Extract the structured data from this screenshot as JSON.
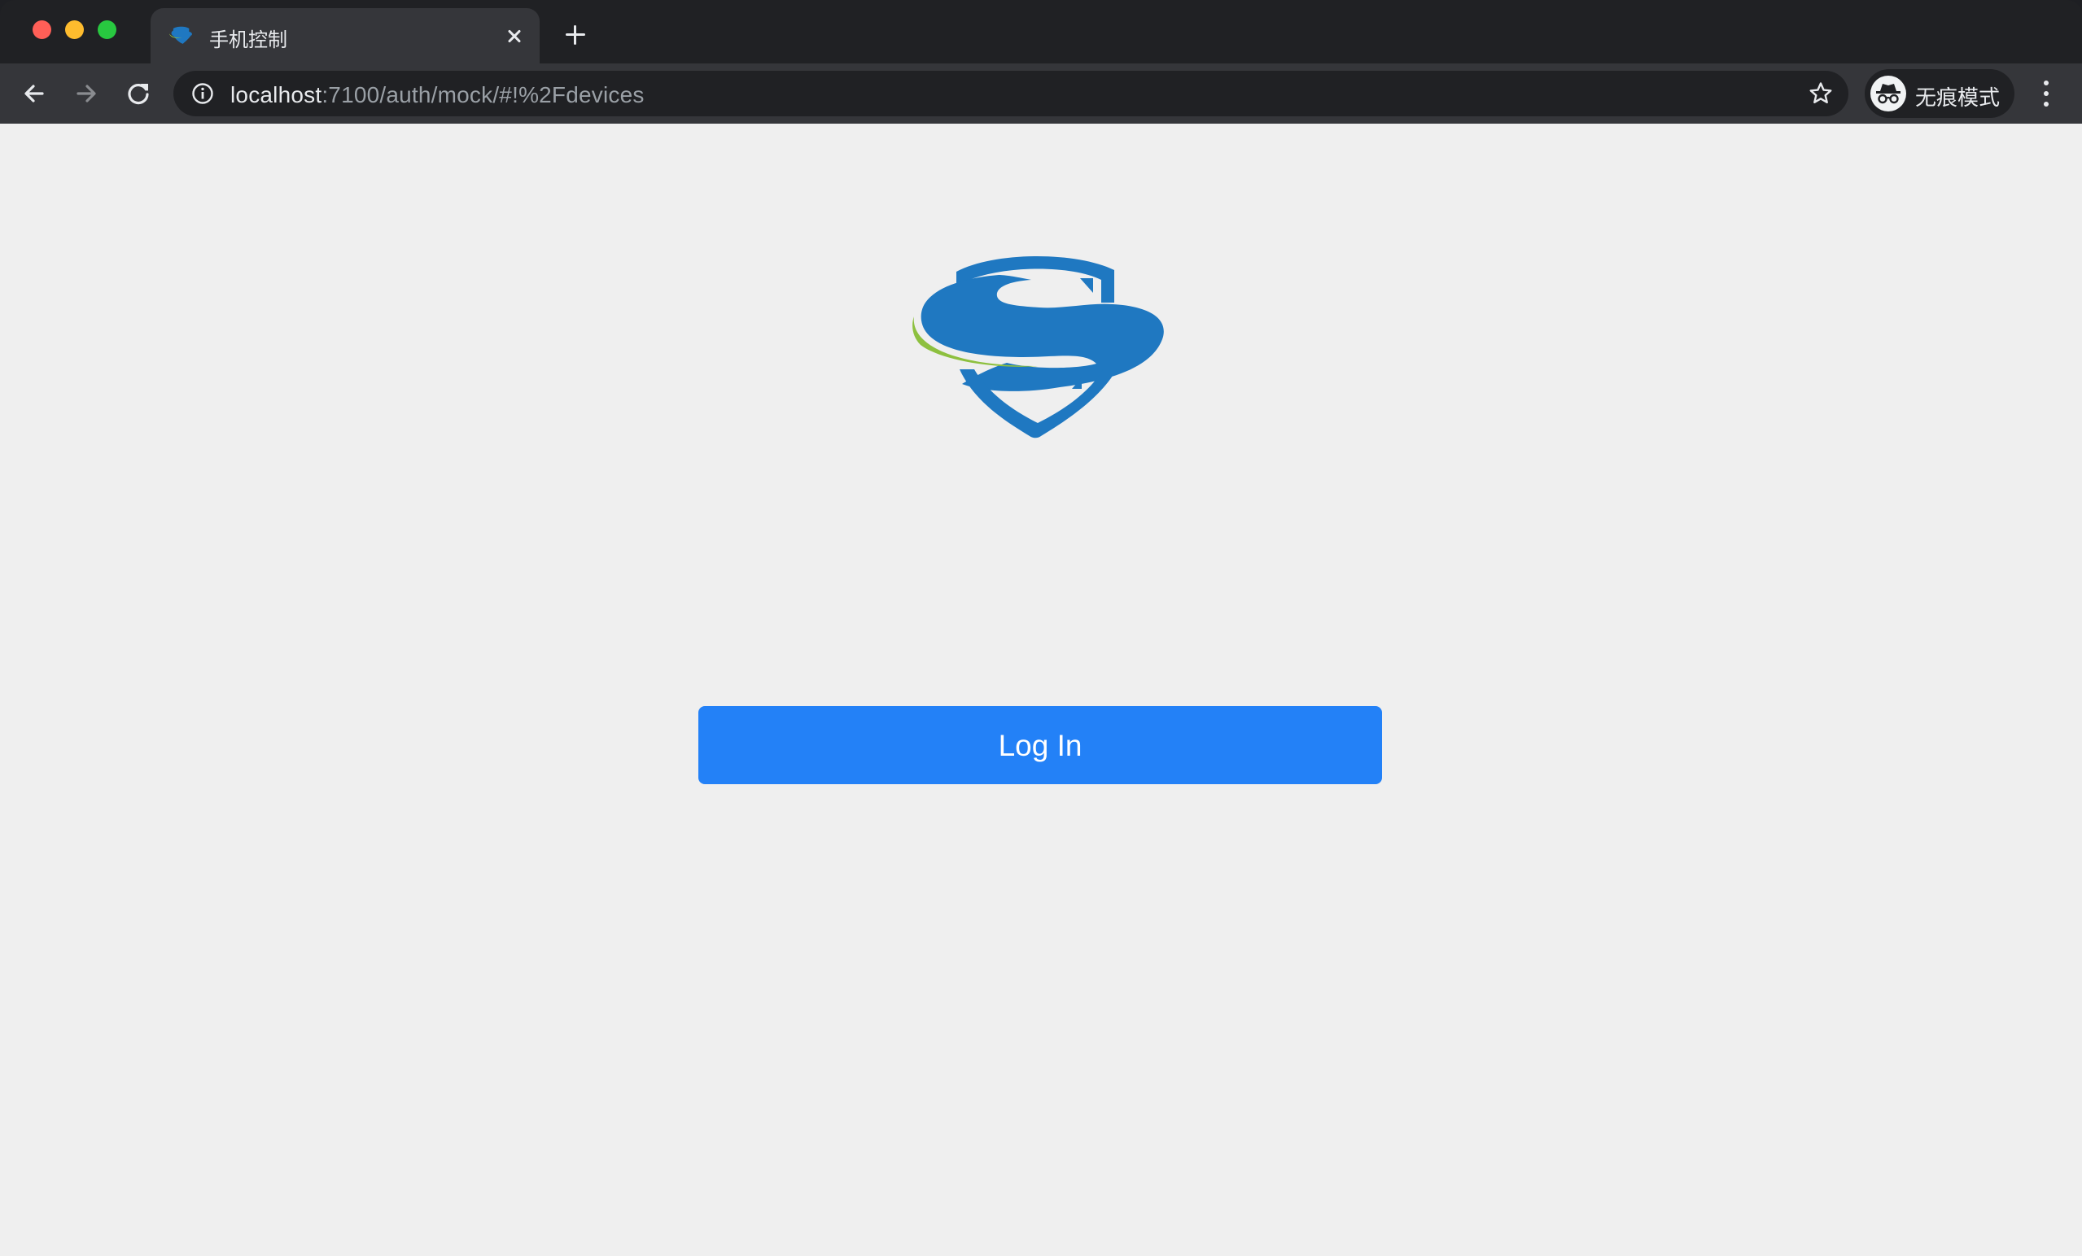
{
  "browser": {
    "tab": {
      "title": "手机控制",
      "favicon": "shield-s-favicon-icon"
    },
    "address_bar": {
      "host": "localhost",
      "path": ":7100/auth/mock/#!%2Fdevices"
    },
    "profile": {
      "label": "无痕模式",
      "icon": "incognito-icon"
    },
    "icons": {
      "back": "back-arrow-icon",
      "forward": "forward-arrow-icon",
      "reload": "reload-icon",
      "info": "info-icon",
      "bookmark": "star-icon",
      "menu": "kebab-menu-icon",
      "close_tab": "close-icon",
      "new_tab": "plus-icon"
    }
  },
  "page": {
    "logo": "shield-s-logo",
    "login_button_label": "Log In"
  },
  "colors": {
    "accent": "#2381f7",
    "logo_blue": "#1f78c1",
    "logo_green": "#8dc03f",
    "page_background": "#efefef"
  }
}
